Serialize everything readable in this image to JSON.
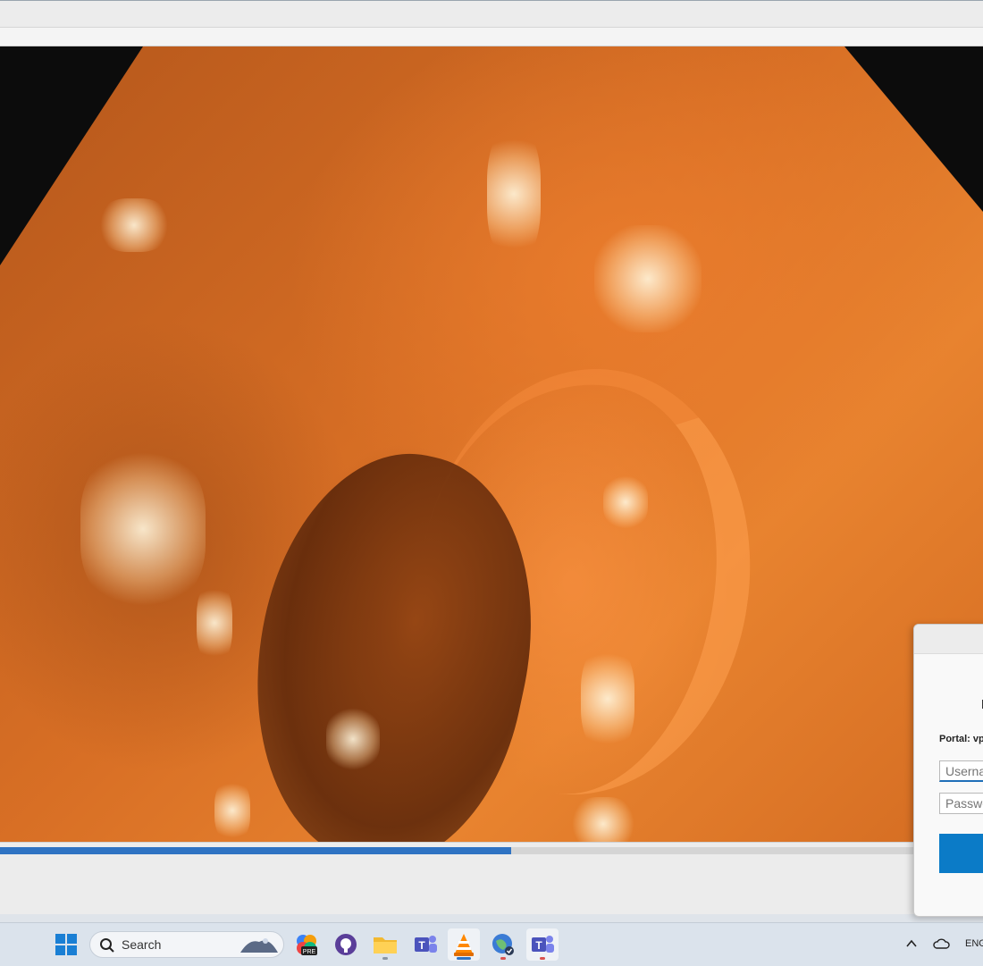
{
  "window": {
    "title": ""
  },
  "player": {
    "progress_percent": 52
  },
  "dialog": {
    "portal_label": "Portal: vp",
    "username_placeholder": "Userna",
    "password_placeholder": "Passwo"
  },
  "taskbar": {
    "search_placeholder": "Search",
    "language": "ENG",
    "apps": [
      {
        "name": "windows-start-icon"
      },
      {
        "name": "copilot-pre-icon"
      },
      {
        "name": "github-icon"
      },
      {
        "name": "file-explorer-icon"
      },
      {
        "name": "teams-icon"
      },
      {
        "name": "vlc-icon"
      },
      {
        "name": "globalprotect-icon"
      },
      {
        "name": "teams-work-icon"
      }
    ]
  }
}
